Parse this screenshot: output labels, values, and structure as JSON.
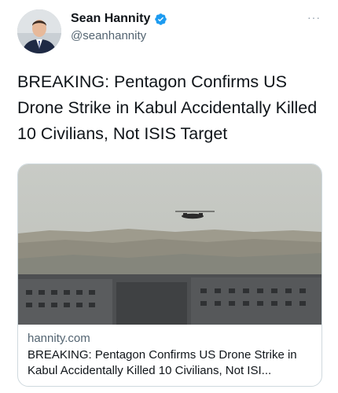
{
  "author": {
    "display_name": "Sean Hannity",
    "handle": "@seanhannity",
    "verified": true,
    "avatar_icon": "profile-photo",
    "verified_icon": "verified-badge-icon"
  },
  "menu": {
    "more_label": "···"
  },
  "tweet": {
    "text": "BREAKING: Pentagon Confirms US Drone Strike in Kabul Accidentally Killed 10 Civilians, Not ISIS Target"
  },
  "link_card": {
    "domain": "hannity.com",
    "title": "BREAKING: Pentagon Confirms US Drone Strike in Kabul Accidentally Killed 10 Civilians, Not ISI..."
  },
  "colors": {
    "text_primary": "#0f1419",
    "text_secondary": "#536471",
    "verified_blue": "#1d9bf0",
    "border": "#cfd9de"
  }
}
